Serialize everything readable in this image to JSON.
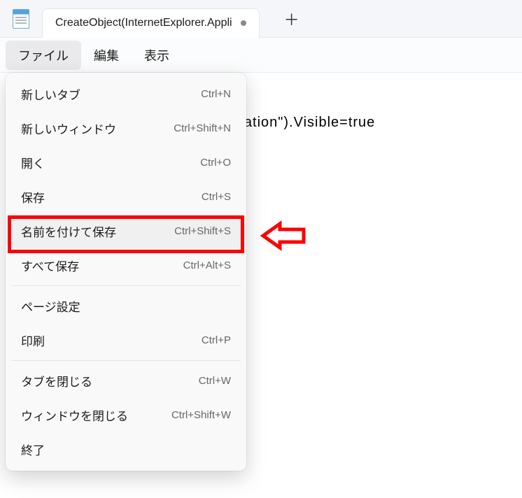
{
  "app": {
    "tab_title": "CreateObject(InternetExplorer.Appli"
  },
  "menubar": {
    "file": "ファイル",
    "edit": "編集",
    "view": "表示"
  },
  "editor": {
    "visible_text": ".Application\").Visible=true"
  },
  "file_menu": {
    "items": [
      {
        "label": "新しいタブ",
        "shortcut": "Ctrl+N"
      },
      {
        "label": "新しいウィンドウ",
        "shortcut": "Ctrl+Shift+N"
      },
      {
        "label": "開く",
        "shortcut": "Ctrl+O"
      },
      {
        "label": "保存",
        "shortcut": "Ctrl+S"
      },
      {
        "label": "名前を付けて保存",
        "shortcut": "Ctrl+Shift+S",
        "highlighted": true
      },
      {
        "label": "すべて保存",
        "shortcut": "Ctrl+Alt+S"
      },
      {
        "separator": true
      },
      {
        "label": "ページ設定",
        "shortcut": ""
      },
      {
        "label": "印刷",
        "shortcut": "Ctrl+P"
      },
      {
        "separator": true
      },
      {
        "label": "タブを閉じる",
        "shortcut": "Ctrl+W"
      },
      {
        "label": "ウィンドウを閉じる",
        "shortcut": "Ctrl+Shift+W"
      },
      {
        "label": "終了",
        "shortcut": ""
      }
    ]
  },
  "annotations": {
    "highlight_target": "save-as-menu-item",
    "arrow_color": "#ff0000"
  }
}
